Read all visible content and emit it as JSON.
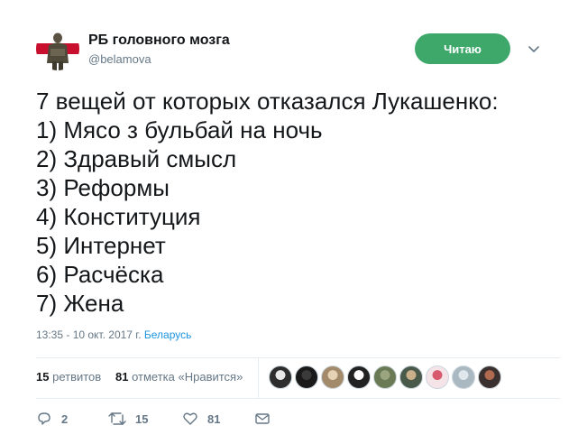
{
  "user": {
    "name": "РБ головного мозга",
    "handle": "@belamova",
    "follow_label": "Читаю"
  },
  "tweet": {
    "lines": [
      "7 вещей от которых отказался Лукашенко:",
      "1) Мясо з бульбай на ночь",
      "2) Здравый смысл",
      "3) Реформы",
      "4) Конституция",
      "5) Интернет",
      "6) Расчёска",
      "7) Жена"
    ],
    "timestamp": "13:35 - 10 окт. 2017 г.",
    "location": "Беларусь"
  },
  "stats": {
    "retweets_count": "15",
    "retweets_label": "ретвитов",
    "likes_count": "81",
    "likes_label": "отметка «Нравится»"
  },
  "likers": [
    {
      "color": "#2d2d2d",
      "accent": "#e8e8e8"
    },
    {
      "color": "#1a1a1a",
      "accent": "#3a3a3a"
    },
    {
      "color": "#a38a6b",
      "accent": "#e6d2b4"
    },
    {
      "color": "#222222",
      "accent": "#ffffff"
    },
    {
      "color": "#6a7a55",
      "accent": "#9aa57f"
    },
    {
      "color": "#4a5a4a",
      "accent": "#c9b08a"
    },
    {
      "color": "#f4e4e8",
      "accent": "#d85a6e"
    },
    {
      "color": "#aab8c2",
      "accent": "#e1e8ed"
    },
    {
      "color": "#3a3030",
      "accent": "#b06a50"
    }
  ],
  "actions": {
    "reply_count": "2",
    "retweet_count": "15",
    "like_count": "81"
  },
  "icons": [
    "chevron-down-icon",
    "reply-icon",
    "retweet-icon",
    "like-icon",
    "message-icon"
  ],
  "colors": {
    "follow_button": "#3ea86b",
    "link": "#1b95e0",
    "secondary_text": "#657786"
  }
}
